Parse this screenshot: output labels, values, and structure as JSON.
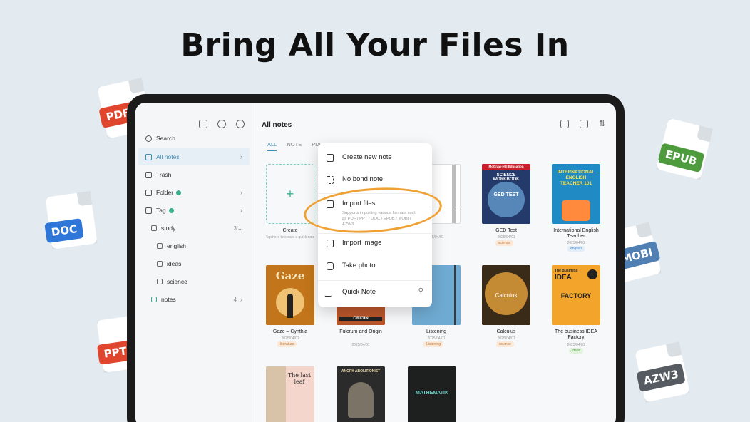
{
  "headline": "Bring All Your Files In",
  "badges": [
    {
      "label": "PDF",
      "color": "#e0452d"
    },
    {
      "label": "DOC",
      "color": "#2e77d8"
    },
    {
      "label": "PPT",
      "color": "#e0452d"
    },
    {
      "label": "EPUB",
      "color": "#4d9b3d"
    },
    {
      "label": "MOBI",
      "color": "#4f7fb3"
    },
    {
      "label": "AZW3",
      "color": "#555b60"
    }
  ],
  "sidebar": {
    "items": [
      {
        "label": "Search"
      },
      {
        "label": "All notes"
      },
      {
        "label": "Trash"
      },
      {
        "label": "Folder"
      },
      {
        "label": "Tag"
      },
      {
        "label": "study",
        "count": "3"
      },
      {
        "label": "english"
      },
      {
        "label": "ideas"
      },
      {
        "label": "science"
      },
      {
        "label": "notes",
        "count": "4"
      }
    ]
  },
  "main": {
    "title": "All notes",
    "tabs": [
      "ALL",
      "NOTE",
      "PDF"
    ],
    "create_label": "Create",
    "create_hint": "Tap here to create a quick note",
    "cards": [
      {
        "label": "d note",
        "date": "2025/04/01"
      },
      {
        "label": "GED Test",
        "date": "2025/04/01",
        "tag": "science"
      },
      {
        "label": "International English Teacher",
        "date": "2025/04/01",
        "tag": "english"
      },
      {
        "label": "Gaze – Cynthia",
        "date": "2025/04/01",
        "tag": "literature"
      },
      {
        "label": "Fulcrum and Origin",
        "date": "2025/04/01"
      },
      {
        "label": "Listening",
        "date": "2025/04/01",
        "tag": "Listening"
      },
      {
        "label": "Calculus",
        "date": "2025/04/01",
        "tag": "science"
      },
      {
        "label": "The business IDEA Factory",
        "date": "2025/04/01",
        "tag": "Ideas"
      }
    ],
    "covers": {
      "ged_publisher": "McGraw-Hill Education",
      "ged_title": "SCIENCE WORKBOOK",
      "ged_test": "GED TEST",
      "iet_title": "INTERNATIONAL ENGLISH TEACHER 101",
      "gaze": "Gaze",
      "origin": "ORIGIN",
      "calculus": "Calculus",
      "idea_top": "The Business",
      "idea_mid": "IDEA",
      "idea_bot": "FACTORY",
      "leaf": "The last leaf",
      "angry": "ANGRY ABOLITIONIST",
      "math": "MATHEMATIK"
    }
  },
  "menu": {
    "create_new_note": "Create new note",
    "no_bond_note": "No bond note",
    "import_files": "Import files",
    "import_files_hint": "Supports importing various formats such as PDF / PPT / DOC / EPUB / MOBI / AZW3",
    "import_image": "Import image",
    "take_photo": "Take photo",
    "quick_note": "Quick Note"
  }
}
